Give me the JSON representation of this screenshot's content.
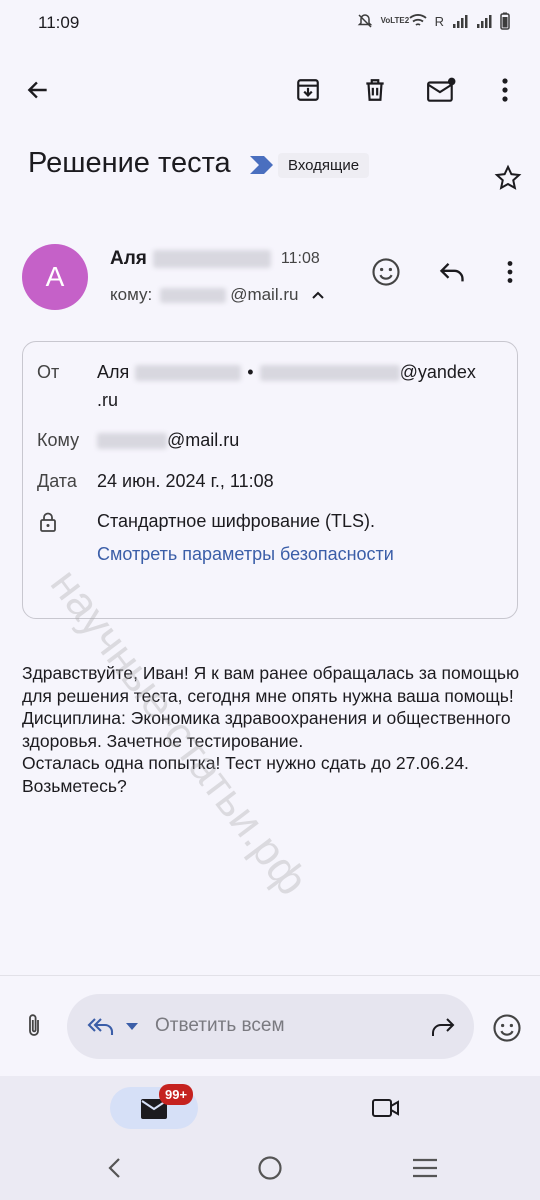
{
  "status_bar": {
    "time": "11:09",
    "volte": "VoLTE2",
    "roaming": "R"
  },
  "toolbar": {
    "back_icon": "arrow-left-icon",
    "archive_icon": "archive-icon",
    "delete_icon": "trash-icon",
    "mark_unread_icon": "mail-unread-icon",
    "more_icon": "more-vert-icon"
  },
  "subject": {
    "title": "Решение теста",
    "label": "Входящие"
  },
  "message": {
    "avatar_letter": "A",
    "sender_first_name": "Аля",
    "time": "11:08",
    "to_prefix": "кому:",
    "to_domain": "@mail.ru"
  },
  "details": {
    "from_label": "От",
    "from_name": "Аля",
    "from_domain": "@yandex",
    "from_domain_2": ".ru",
    "to_label": "Кому",
    "to_domain": "@mail.ru",
    "date_label": "Дата",
    "date_value": "24 июн. 2024 г., 11:08",
    "encryption": "Стандартное шифрование (TLS).",
    "security_link": "Смотреть параметры безопасности"
  },
  "body": "Здравствуйте, Иван!  Я к вам ранее обращалась за помощью для решения теста, сегодня мне опять нужна ваша помощь!\nДисциплина: Экономика здравоохранения и общественного здоровья. Зачетное тестирование.\nОсталась одна попытка! Тест нужно сдать до 27.06.24.\nВозьметесь?",
  "watermark": "научные-статьи.рф",
  "reply": {
    "placeholder": "Ответить всем"
  },
  "bottom_nav": {
    "mail_badge": "99+"
  },
  "colors": {
    "accent": "#3b5ea8",
    "avatar": "#c561c8",
    "badge": "#c5221f",
    "label_arrow": "#4a6fbf"
  }
}
